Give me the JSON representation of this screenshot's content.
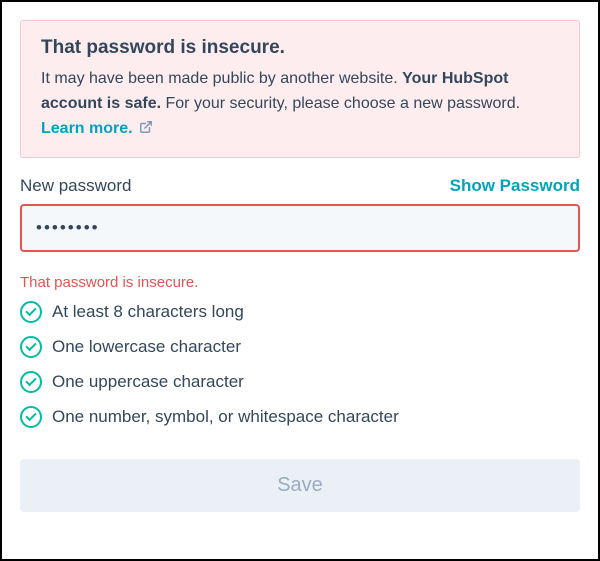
{
  "alert": {
    "title": "That password is insecure.",
    "body_pre": "It may have been made public by another website. ",
    "body_strong": "Your HubSpot account is safe.",
    "body_post": " For your security, please choose a new password. ",
    "learn_more": "Learn more."
  },
  "field": {
    "label": "New password",
    "show_password": "Show Password",
    "value": "••••••••"
  },
  "inline_error": "That password is insecure.",
  "requirements": [
    {
      "label": "At least 8 characters long",
      "met": true
    },
    {
      "label": "One lowercase character",
      "met": true
    },
    {
      "label": "One uppercase character",
      "met": true
    },
    {
      "label": "One number, symbol, or whitespace character",
      "met": true
    }
  ],
  "save_label": "Save",
  "colors": {
    "accent": "#00a4bd",
    "success": "#00bda5",
    "error": "#e55353",
    "text": "#33475b",
    "alert_bg": "#fdedee"
  }
}
